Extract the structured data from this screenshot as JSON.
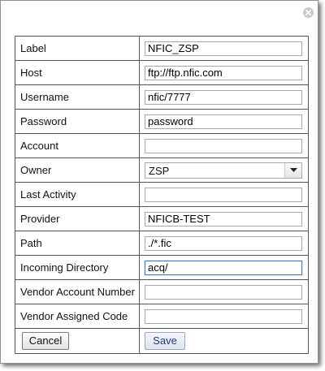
{
  "dialog": {
    "close_icon": "close-circle-icon"
  },
  "form": {
    "fields": [
      {
        "label": "Label",
        "value": "NFIC_ZSP"
      },
      {
        "label": "Host",
        "value": "ftp://ftp.nfic.com"
      },
      {
        "label": "Username",
        "value": "nfic/7777"
      },
      {
        "label": "Password",
        "value": "password"
      },
      {
        "label": "Account",
        "value": ""
      },
      {
        "label": "Owner",
        "value": "ZSP"
      },
      {
        "label": "Last Activity",
        "value": ""
      },
      {
        "label": "Provider",
        "value": "NFICB-TEST"
      },
      {
        "label": "Path",
        "value": "./*.fic"
      },
      {
        "label": "Incoming Directory",
        "value": "acq/"
      },
      {
        "label": "Vendor Account Number",
        "value": ""
      },
      {
        "label": "Vendor Assigned Code",
        "value": ""
      }
    ]
  },
  "buttons": {
    "cancel_label": "Cancel",
    "save_label": "Save"
  }
}
